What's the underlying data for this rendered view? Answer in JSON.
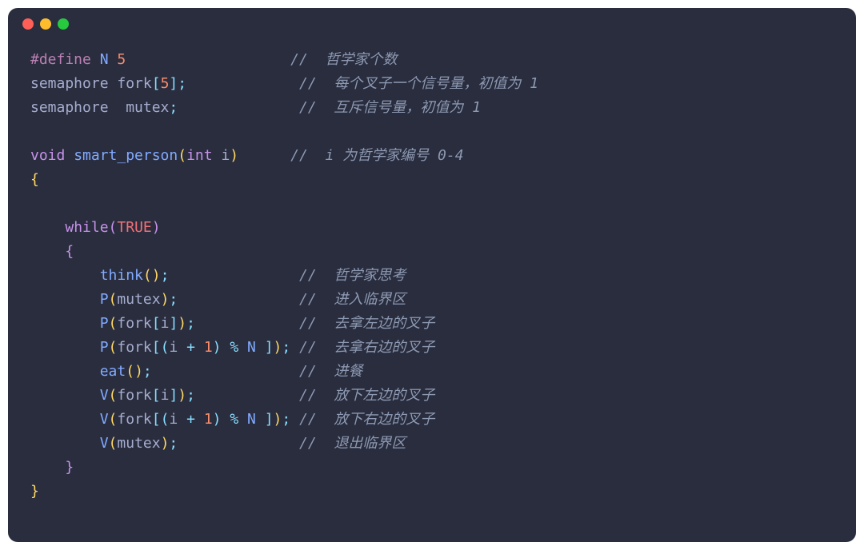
{
  "colors": {
    "bg": "#292d3e",
    "fg": "#a6accd",
    "comment": "#8d99b2",
    "keyword": "#c792ea",
    "number": "#f78c6c",
    "func": "#82aaff",
    "punct": "#89ddff",
    "brace_yellow": "#ffd866"
  },
  "lines": [
    {
      "tokens": [
        {
          "t": "#define ",
          "c": "c-define"
        },
        {
          "t": "N ",
          "c": "c-macro"
        },
        {
          "t": "5",
          "c": "c-number"
        },
        {
          "t": "                   ",
          "c": ""
        },
        {
          "t": "//  哲学家个数",
          "c": "c-comment"
        }
      ]
    },
    {
      "tokens": [
        {
          "t": "semaphore fork",
          "c": "c-ident"
        },
        {
          "t": "[",
          "c": "c-punct"
        },
        {
          "t": "5",
          "c": "c-number"
        },
        {
          "t": "];",
          "c": "c-punct"
        },
        {
          "t": "             ",
          "c": ""
        },
        {
          "t": "//  每个叉子一个信号量，初值为 1",
          "c": "c-comment"
        }
      ]
    },
    {
      "tokens": [
        {
          "t": "semaphore  mutex",
          "c": "c-ident"
        },
        {
          "t": ";",
          "c": "c-punct"
        },
        {
          "t": "              ",
          "c": ""
        },
        {
          "t": "//  互斥信号量，初值为 1",
          "c": "c-comment"
        }
      ]
    },
    {
      "tokens": [
        {
          "t": " ",
          "c": ""
        }
      ]
    },
    {
      "tokens": [
        {
          "t": "void ",
          "c": "c-keyword"
        },
        {
          "t": "smart_person",
          "c": "c-func"
        },
        {
          "t": "(",
          "c": "c-brace"
        },
        {
          "t": "int ",
          "c": "c-keyword"
        },
        {
          "t": "i",
          "c": "c-ident"
        },
        {
          "t": ")",
          "c": "c-brace"
        },
        {
          "t": "      ",
          "c": ""
        },
        {
          "t": "//  i 为哲学家编号 0-4",
          "c": "c-comment"
        }
      ]
    },
    {
      "tokens": [
        {
          "t": "{",
          "c": "c-brace"
        }
      ]
    },
    {
      "tokens": [
        {
          "t": " ",
          "c": ""
        }
      ]
    },
    {
      "tokens": [
        {
          "t": "    ",
          "c": ""
        },
        {
          "t": "while",
          "c": "c-keyword"
        },
        {
          "t": "(",
          "c": "c-brace2"
        },
        {
          "t": "TRUE",
          "c": "c-const"
        },
        {
          "t": ")",
          "c": "c-brace2"
        }
      ]
    },
    {
      "tokens": [
        {
          "t": "    ",
          "c": ""
        },
        {
          "t": "{",
          "c": "c-brace2"
        }
      ]
    },
    {
      "tokens": [
        {
          "t": "        ",
          "c": ""
        },
        {
          "t": "think",
          "c": "c-func"
        },
        {
          "t": "(",
          "c": "c-paren2"
        },
        {
          "t": ")",
          "c": "c-paren2"
        },
        {
          "t": ";",
          "c": "c-punct"
        },
        {
          "t": "               ",
          "c": ""
        },
        {
          "t": "//  哲学家思考",
          "c": "c-comment"
        }
      ]
    },
    {
      "tokens": [
        {
          "t": "        ",
          "c": ""
        },
        {
          "t": "P",
          "c": "c-func"
        },
        {
          "t": "(",
          "c": "c-paren2"
        },
        {
          "t": "mutex",
          "c": "c-ident"
        },
        {
          "t": ")",
          "c": "c-paren2"
        },
        {
          "t": ";",
          "c": "c-punct"
        },
        {
          "t": "              ",
          "c": ""
        },
        {
          "t": "//  进入临界区",
          "c": "c-comment"
        }
      ]
    },
    {
      "tokens": [
        {
          "t": "        ",
          "c": ""
        },
        {
          "t": "P",
          "c": "c-func"
        },
        {
          "t": "(",
          "c": "c-paren2"
        },
        {
          "t": "fork",
          "c": "c-ident"
        },
        {
          "t": "[",
          "c": "c-punct"
        },
        {
          "t": "i",
          "c": "c-ident"
        },
        {
          "t": "]",
          "c": "c-punct"
        },
        {
          "t": ")",
          "c": "c-paren2"
        },
        {
          "t": ";",
          "c": "c-punct"
        },
        {
          "t": "            ",
          "c": ""
        },
        {
          "t": "//  去拿左边的叉子",
          "c": "c-comment"
        }
      ]
    },
    {
      "tokens": [
        {
          "t": "        ",
          "c": ""
        },
        {
          "t": "P",
          "c": "c-func"
        },
        {
          "t": "(",
          "c": "c-paren2"
        },
        {
          "t": "fork",
          "c": "c-ident"
        },
        {
          "t": "[",
          "c": "c-punct"
        },
        {
          "t": "(",
          "c": "c-paren3"
        },
        {
          "t": "i ",
          "c": "c-ident"
        },
        {
          "t": "+ ",
          "c": "c-op"
        },
        {
          "t": "1",
          "c": "c-number"
        },
        {
          "t": ")",
          "c": "c-paren3"
        },
        {
          "t": " % ",
          "c": "c-op"
        },
        {
          "t": "N ",
          "c": "c-macro"
        },
        {
          "t": "]",
          "c": "c-punct"
        },
        {
          "t": ")",
          "c": "c-paren2"
        },
        {
          "t": ";",
          "c": "c-punct"
        },
        {
          "t": " ",
          "c": ""
        },
        {
          "t": "//  去拿右边的叉子",
          "c": "c-comment"
        }
      ]
    },
    {
      "tokens": [
        {
          "t": "        ",
          "c": ""
        },
        {
          "t": "eat",
          "c": "c-func"
        },
        {
          "t": "(",
          "c": "c-paren2"
        },
        {
          "t": ")",
          "c": "c-paren2"
        },
        {
          "t": ";",
          "c": "c-punct"
        },
        {
          "t": "                 ",
          "c": ""
        },
        {
          "t": "//  进餐",
          "c": "c-comment"
        }
      ]
    },
    {
      "tokens": [
        {
          "t": "        ",
          "c": ""
        },
        {
          "t": "V",
          "c": "c-func"
        },
        {
          "t": "(",
          "c": "c-paren2"
        },
        {
          "t": "fork",
          "c": "c-ident"
        },
        {
          "t": "[",
          "c": "c-punct"
        },
        {
          "t": "i",
          "c": "c-ident"
        },
        {
          "t": "]",
          "c": "c-punct"
        },
        {
          "t": ")",
          "c": "c-paren2"
        },
        {
          "t": ";",
          "c": "c-punct"
        },
        {
          "t": "            ",
          "c": ""
        },
        {
          "t": "//  放下左边的叉子",
          "c": "c-comment"
        }
      ]
    },
    {
      "tokens": [
        {
          "t": "        ",
          "c": ""
        },
        {
          "t": "V",
          "c": "c-func"
        },
        {
          "t": "(",
          "c": "c-paren2"
        },
        {
          "t": "fork",
          "c": "c-ident"
        },
        {
          "t": "[",
          "c": "c-punct"
        },
        {
          "t": "(",
          "c": "c-paren3"
        },
        {
          "t": "i ",
          "c": "c-ident"
        },
        {
          "t": "+ ",
          "c": "c-op"
        },
        {
          "t": "1",
          "c": "c-number"
        },
        {
          "t": ")",
          "c": "c-paren3"
        },
        {
          "t": " % ",
          "c": "c-op"
        },
        {
          "t": "N ",
          "c": "c-macro"
        },
        {
          "t": "]",
          "c": "c-punct"
        },
        {
          "t": ")",
          "c": "c-paren2"
        },
        {
          "t": ";",
          "c": "c-punct"
        },
        {
          "t": " ",
          "c": ""
        },
        {
          "t": "//  放下右边的叉子",
          "c": "c-comment"
        }
      ]
    },
    {
      "tokens": [
        {
          "t": "        ",
          "c": ""
        },
        {
          "t": "V",
          "c": "c-func"
        },
        {
          "t": "(",
          "c": "c-paren2"
        },
        {
          "t": "mutex",
          "c": "c-ident"
        },
        {
          "t": ")",
          "c": "c-paren2"
        },
        {
          "t": ";",
          "c": "c-punct"
        },
        {
          "t": "              ",
          "c": ""
        },
        {
          "t": "//  退出临界区",
          "c": "c-comment"
        }
      ]
    },
    {
      "tokens": [
        {
          "t": "    ",
          "c": ""
        },
        {
          "t": "}",
          "c": "c-brace2"
        }
      ]
    },
    {
      "tokens": [
        {
          "t": "}",
          "c": "c-brace"
        }
      ]
    }
  ]
}
